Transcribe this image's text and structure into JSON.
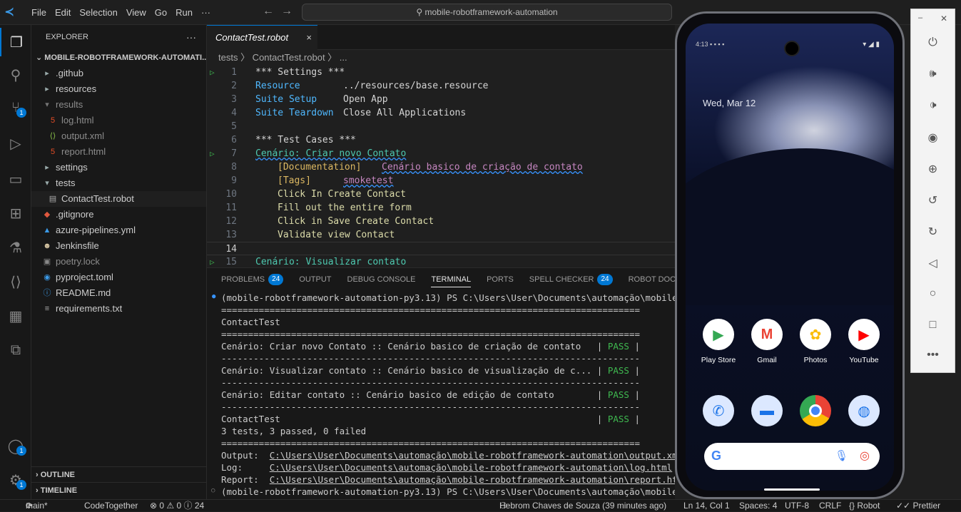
{
  "menu": [
    "File",
    "Edit",
    "Selection",
    "View",
    "Go",
    "Run",
    "···"
  ],
  "search": {
    "text": "mobile-robotframework-automation"
  },
  "activity_badges": {
    "scm": "1",
    "accounts": "1",
    "settings": "1"
  },
  "explorer": {
    "title": "EXPLORER",
    "more": "···",
    "root": "MOBILE-ROBOTFRAMEWORK-AUTOMATI...",
    "items": [
      {
        "label": ".github",
        "icon": "folder-icon"
      },
      {
        "label": "resources",
        "icon": "folder-icon"
      },
      {
        "label": "results",
        "icon": "folder-icon"
      },
      {
        "label": "log.html",
        "icon": "html-icon"
      },
      {
        "label": "output.xml",
        "icon": "xml-icon"
      },
      {
        "label": "report.html",
        "icon": "html-icon"
      },
      {
        "label": "settings",
        "icon": "folder-icon"
      },
      {
        "label": "tests",
        "icon": "folder-icon"
      },
      {
        "label": "ContactTest.robot",
        "icon": "file-icon"
      },
      {
        "label": ".gitignore",
        "icon": "git-icon"
      },
      {
        "label": "azure-pipelines.yml",
        "icon": "yaml-icon"
      },
      {
        "label": "Jenkinsfile",
        "icon": "jenkins-icon"
      },
      {
        "label": "poetry.lock",
        "icon": "lock-icon"
      },
      {
        "label": "pyproject.toml",
        "icon": "toml-icon"
      },
      {
        "label": "README.md",
        "icon": "info-icon"
      },
      {
        "label": "requirements.txt",
        "icon": "text-icon"
      }
    ],
    "outline": "OUTLINE",
    "timeline": "TIMELINE"
  },
  "editor": {
    "tab": "ContactTest.robot",
    "close": "×",
    "breadcrumb": "tests 〉 ContactTest.robot 〉 ...",
    "line_numbers": [
      "1",
      "2",
      "3",
      "4",
      "5",
      "6",
      "7",
      "8",
      "9",
      "10",
      "11",
      "12",
      "13",
      "14",
      "15"
    ],
    "l1": "*** Settings ***",
    "l2a": "Resource",
    "l2b": "../resources/base.resource",
    "l3a": "Suite Setup",
    "l3b": "Open App",
    "l4a": "Suite Teardown",
    "l4b": "Close All Applications",
    "l6": "*** Test Cases ***",
    "l7": "Cenário: Criar novo Contato",
    "l8a": "[Documentation]",
    "l8b": "Cenário basico de criação de contato",
    "l9a": "[Tags]",
    "l9b": "smoketest",
    "l10": "Click In Create Contact",
    "l11": "Fill out the entire form",
    "l12": "Click in Save Create Contact",
    "l13": "Validate view Contact",
    "l15": "Cenário: Visualizar contato"
  },
  "panel": {
    "tabs": [
      "PROBLEMS",
      "OUTPUT",
      "DEBUG CONSOLE",
      "TERMINAL",
      "PORTS",
      "SPELL CHECKER",
      "ROBOT DOCUMENTATI"
    ],
    "problems_count": "24",
    "spell_count": "24",
    "t_prompt": "(mobile-robotframework-automation-py3.13) PS C:\\Users\\User\\Documents\\automação\\mobile-robotf",
    "t_sep_eq": "==============================================================================",
    "t_sep_dash": "------------------------------------------------------------------------------",
    "t_suite": "ContactTest",
    "t_r1": "Cenário: Criar novo Contato :: Cenário basico de criação de contato   | ",
    "t_r2": "Cenário: Visualizar contato :: Cenário basico de visualização de c... | ",
    "t_r3": "Cenário: Editar contato :: Cenário basico de edição de contato        | ",
    "t_r4": "ContactTest                                                           | ",
    "t_pass": "PASS",
    "t_bar": " |",
    "t_summary": "3 tests, 3 passed, 0 failed",
    "t_out_l": "Output:  ",
    "t_out": "C:\\Users\\User\\Documents\\automação\\mobile-robotframework-automation\\output.xml",
    "t_log_l": "Log:     ",
    "t_log": "C:\\Users\\User\\Documents\\automação\\mobile-robotframework-automation\\log.html",
    "t_rep_l": "Report:  ",
    "t_rep": "C:\\Users\\User\\Documents\\automação\\mobile-robotframework-automation\\report.html",
    "t_prompt2": "(mobile-robotframework-automation-py3.13) PS C:\\Users\\User\\Documents\\automação\\mobile-robotfr"
  },
  "phone": {
    "time": "4:13",
    "date": "Wed, Mar 12",
    "apps_row1": [
      "Play Store",
      "Gmail",
      "Photos",
      "YouTube"
    ]
  },
  "status": {
    "branch": "main*",
    "codetogether": "CodeTogether",
    "problems": "⊗ 0 ⚠ 0 ⓘ 24",
    "blame": "Hebrom Chaves de Souza (39 minutes ago)",
    "position": "Ln 14, Col 1",
    "spaces": "Spaces: 4",
    "encoding": "UTF-8",
    "eol": "CRLF",
    "language": "{} Robot",
    "prettier": "✓✓ Prettier"
  }
}
